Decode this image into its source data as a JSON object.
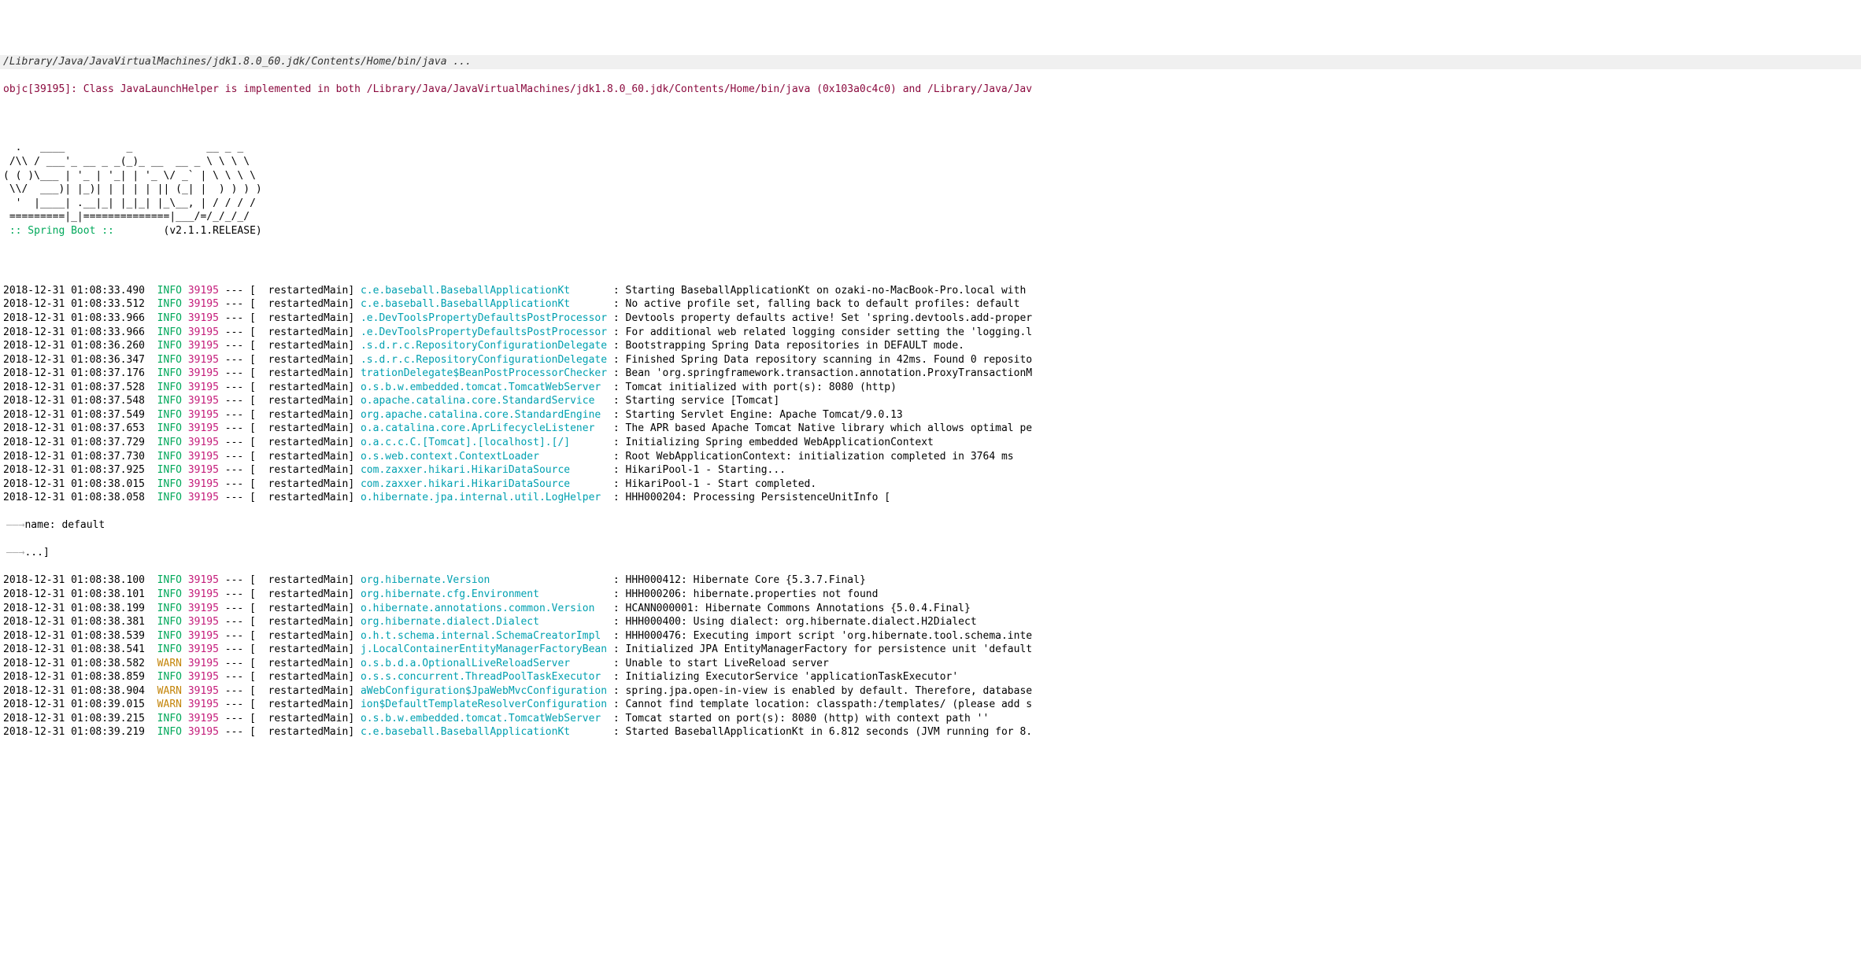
{
  "header": {
    "exec_line": "/Library/Java/JavaVirtualMachines/jdk1.8.0_60.jdk/Contents/Home/bin/java ...",
    "objc_line": "objc[39195]: Class JavaLaunchHelper is implemented in both /Library/Java/JavaVirtualMachines/jdk1.8.0_60.jdk/Contents/Home/bin/java (0x103a0c4c0) and /Library/Java/Jav"
  },
  "banner": {
    "ascii": "  .   ____          _            __ _ _\n /\\\\ / ___'_ __ _ _(_)_ __  __ _ \\ \\ \\ \\\n( ( )\\___ | '_ | '_| | '_ \\/ _` | \\ \\ \\ \\\n \\\\/  ___)| |_)| | | | | || (_| |  ) ) ) )\n  '  |____| .__|_| |_|_| |_\\__, | / / / /\n =========|_|==============|___/=/_/_/_/",
    "spring_boot": " :: Spring Boot :: ",
    "version": "       (v2.1.1.RELEASE)"
  },
  "indent": {
    "name_line": "name: default",
    "ellipsis_line": "...]"
  },
  "logs": [
    {
      "ts": "2018-12-31 01:08:33.490",
      "lvl": "INFO",
      "pid": "39195",
      "thread": "restartedMain",
      "logger": "c.e.baseball.BaseballApplicationKt      ",
      "msg": "Starting BaseballApplicationKt on ozaki-no-MacBook-Pro.local with"
    },
    {
      "ts": "2018-12-31 01:08:33.512",
      "lvl": "INFO",
      "pid": "39195",
      "thread": "restartedMain",
      "logger": "c.e.baseball.BaseballApplicationKt      ",
      "msg": "No active profile set, falling back to default profiles: default"
    },
    {
      "ts": "2018-12-31 01:08:33.966",
      "lvl": "INFO",
      "pid": "39195",
      "thread": "restartedMain",
      "logger": ".e.DevToolsPropertyDefaultsPostProcessor",
      "msg": "Devtools property defaults active! Set 'spring.devtools.add-proper"
    },
    {
      "ts": "2018-12-31 01:08:33.966",
      "lvl": "INFO",
      "pid": "39195",
      "thread": "restartedMain",
      "logger": ".e.DevToolsPropertyDefaultsPostProcessor",
      "msg": "For additional web related logging consider setting the 'logging.l"
    },
    {
      "ts": "2018-12-31 01:08:36.260",
      "lvl": "INFO",
      "pid": "39195",
      "thread": "restartedMain",
      "logger": ".s.d.r.c.RepositoryConfigurationDelegate",
      "msg": "Bootstrapping Spring Data repositories in DEFAULT mode."
    },
    {
      "ts": "2018-12-31 01:08:36.347",
      "lvl": "INFO",
      "pid": "39195",
      "thread": "restartedMain",
      "logger": ".s.d.r.c.RepositoryConfigurationDelegate",
      "msg": "Finished Spring Data repository scanning in 42ms. Found 0 reposito"
    },
    {
      "ts": "2018-12-31 01:08:37.176",
      "lvl": "INFO",
      "pid": "39195",
      "thread": "restartedMain",
      "logger": "trationDelegate$BeanPostProcessorChecker",
      "msg": "Bean 'org.springframework.transaction.annotation.ProxyTransactionM"
    },
    {
      "ts": "2018-12-31 01:08:37.528",
      "lvl": "INFO",
      "pid": "39195",
      "thread": "restartedMain",
      "logger": "o.s.b.w.embedded.tomcat.TomcatWebServer ",
      "msg": "Tomcat initialized with port(s): 8080 (http)"
    },
    {
      "ts": "2018-12-31 01:08:37.548",
      "lvl": "INFO",
      "pid": "39195",
      "thread": "restartedMain",
      "logger": "o.apache.catalina.core.StandardService  ",
      "msg": "Starting service [Tomcat]"
    },
    {
      "ts": "2018-12-31 01:08:37.549",
      "lvl": "INFO",
      "pid": "39195",
      "thread": "restartedMain",
      "logger": "org.apache.catalina.core.StandardEngine ",
      "msg": "Starting Servlet Engine: Apache Tomcat/9.0.13"
    },
    {
      "ts": "2018-12-31 01:08:37.653",
      "lvl": "INFO",
      "pid": "39195",
      "thread": "restartedMain",
      "logger": "o.a.catalina.core.AprLifecycleListener  ",
      "msg": "The APR based Apache Tomcat Native library which allows optimal pe"
    },
    {
      "ts": "2018-12-31 01:08:37.729",
      "lvl": "INFO",
      "pid": "39195",
      "thread": "restartedMain",
      "logger": "o.a.c.c.C.[Tomcat].[localhost].[/]      ",
      "msg": "Initializing Spring embedded WebApplicationContext"
    },
    {
      "ts": "2018-12-31 01:08:37.730",
      "lvl": "INFO",
      "pid": "39195",
      "thread": "restartedMain",
      "logger": "o.s.web.context.ContextLoader           ",
      "msg": "Root WebApplicationContext: initialization completed in 3764 ms"
    },
    {
      "ts": "2018-12-31 01:08:37.925",
      "lvl": "INFO",
      "pid": "39195",
      "thread": "restartedMain",
      "logger": "com.zaxxer.hikari.HikariDataSource      ",
      "msg": "HikariPool-1 - Starting..."
    },
    {
      "ts": "2018-12-31 01:08:38.015",
      "lvl": "INFO",
      "pid": "39195",
      "thread": "restartedMain",
      "logger": "com.zaxxer.hikari.HikariDataSource      ",
      "msg": "HikariPool-1 - Start completed."
    },
    {
      "ts": "2018-12-31 01:08:38.058",
      "lvl": "INFO",
      "pid": "39195",
      "thread": "restartedMain",
      "logger": "o.hibernate.jpa.internal.util.LogHelper ",
      "msg": "HHH000204: Processing PersistenceUnitInfo ["
    }
  ],
  "logs2": [
    {
      "ts": "2018-12-31 01:08:38.100",
      "lvl": "INFO",
      "pid": "39195",
      "thread": "restartedMain",
      "logger": "org.hibernate.Version                   ",
      "msg": "HHH000412: Hibernate Core {5.3.7.Final}"
    },
    {
      "ts": "2018-12-31 01:08:38.101",
      "lvl": "INFO",
      "pid": "39195",
      "thread": "restartedMain",
      "logger": "org.hibernate.cfg.Environment           ",
      "msg": "HHH000206: hibernate.properties not found"
    },
    {
      "ts": "2018-12-31 01:08:38.199",
      "lvl": "INFO",
      "pid": "39195",
      "thread": "restartedMain",
      "logger": "o.hibernate.annotations.common.Version  ",
      "msg": "HCANN000001: Hibernate Commons Annotations {5.0.4.Final}"
    },
    {
      "ts": "2018-12-31 01:08:38.381",
      "lvl": "INFO",
      "pid": "39195",
      "thread": "restartedMain",
      "logger": "org.hibernate.dialect.Dialect           ",
      "msg": "HHH000400: Using dialect: org.hibernate.dialect.H2Dialect"
    },
    {
      "ts": "2018-12-31 01:08:38.539",
      "lvl": "INFO",
      "pid": "39195",
      "thread": "restartedMain",
      "logger": "o.h.t.schema.internal.SchemaCreatorImpl ",
      "msg": "HHH000476: Executing import script 'org.hibernate.tool.schema.inte"
    },
    {
      "ts": "2018-12-31 01:08:38.541",
      "lvl": "INFO",
      "pid": "39195",
      "thread": "restartedMain",
      "logger": "j.LocalContainerEntityManagerFactoryBean",
      "msg": "Initialized JPA EntityManagerFactory for persistence unit 'default"
    },
    {
      "ts": "2018-12-31 01:08:38.582",
      "lvl": "WARN",
      "pid": "39195",
      "thread": "restartedMain",
      "logger": "o.s.b.d.a.OptionalLiveReloadServer      ",
      "msg": "Unable to start LiveReload server"
    },
    {
      "ts": "2018-12-31 01:08:38.859",
      "lvl": "INFO",
      "pid": "39195",
      "thread": "restartedMain",
      "logger": "o.s.s.concurrent.ThreadPoolTaskExecutor ",
      "msg": "Initializing ExecutorService 'applicationTaskExecutor'"
    },
    {
      "ts": "2018-12-31 01:08:38.904",
      "lvl": "WARN",
      "pid": "39195",
      "thread": "restartedMain",
      "logger": "aWebConfiguration$JpaWebMvcConfiguration",
      "msg": "spring.jpa.open-in-view is enabled by default. Therefore, database"
    },
    {
      "ts": "2018-12-31 01:08:39.015",
      "lvl": "WARN",
      "pid": "39195",
      "thread": "restartedMain",
      "logger": "ion$DefaultTemplateResolverConfiguration",
      "msg": "Cannot find template location: classpath:/templates/ (please add s"
    },
    {
      "ts": "2018-12-31 01:08:39.215",
      "lvl": "INFO",
      "pid": "39195",
      "thread": "restartedMain",
      "logger": "o.s.b.w.embedded.tomcat.TomcatWebServer ",
      "msg": "Tomcat started on port(s): 8080 (http) with context path ''"
    },
    {
      "ts": "2018-12-31 01:08:39.219",
      "lvl": "INFO",
      "pid": "39195",
      "thread": "restartedMain",
      "logger": "c.e.baseball.BaseballApplicationKt      ",
      "msg": "Started BaseballApplicationKt in 6.812 seconds (JVM running for 8."
    }
  ]
}
